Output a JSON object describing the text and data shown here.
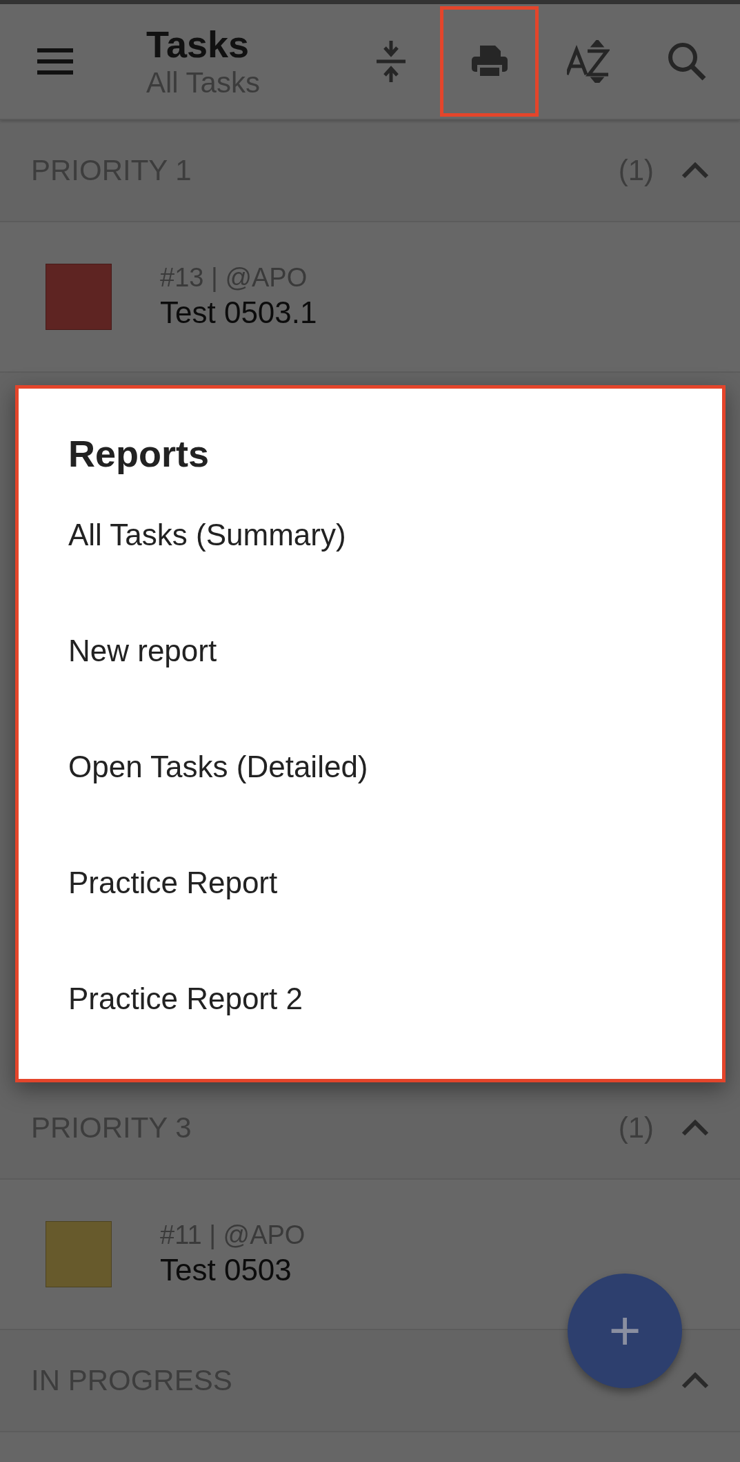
{
  "toolbar": {
    "title": "Tasks",
    "subtitle": "All Tasks",
    "actions": [
      {
        "kind": "collapse",
        "highlighted": false
      },
      {
        "kind": "print",
        "highlighted": true
      },
      {
        "kind": "sort",
        "highlighted": false
      },
      {
        "kind": "search",
        "highlighted": false
      }
    ]
  },
  "sections_top": [
    {
      "title": "PRIORITY 1",
      "count": "(1)",
      "expanded": true,
      "tasks": [
        {
          "meta": "#13 | @APO",
          "title": "Test 0503.1",
          "color": "#5e2422"
        }
      ]
    }
  ],
  "sections_bottom": [
    {
      "title": "PRIORITY 3",
      "count": "(1)",
      "expanded": true,
      "tasks": [
        {
          "meta": "#11 | @APO",
          "title": "Test 0503",
          "color": "#675a2c"
        }
      ]
    },
    {
      "title": "IN PROGRESS",
      "expanded": true
    }
  ],
  "dialog": {
    "title": "Reports",
    "highlighted": true,
    "items": [
      "All Tasks (Summary)",
      "New report",
      "Open Tasks (Detailed)",
      "Practice Report",
      "Practice Report 2"
    ]
  },
  "fab": {
    "label": "+"
  }
}
